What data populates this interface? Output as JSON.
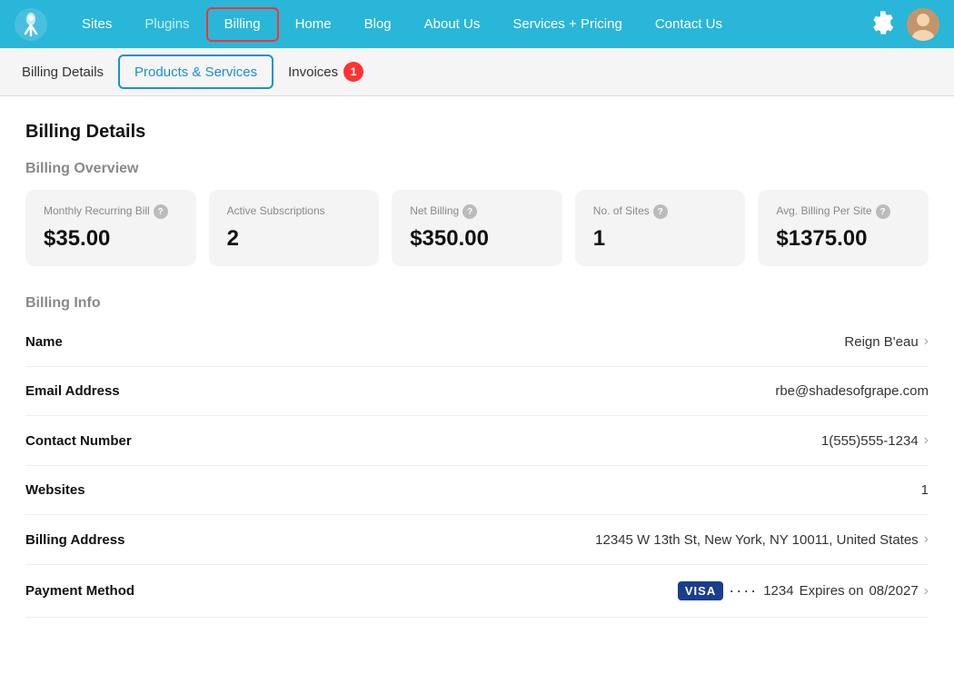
{
  "nav": {
    "links": [
      {
        "label": "Sites",
        "href": "#",
        "class": ""
      },
      {
        "label": "Plugins",
        "href": "#",
        "class": "plugins"
      },
      {
        "label": "Billing",
        "href": "#",
        "class": "active"
      },
      {
        "label": "Home",
        "href": "#",
        "class": ""
      },
      {
        "label": "Blog",
        "href": "#",
        "class": ""
      },
      {
        "label": "About Us",
        "href": "#",
        "class": ""
      },
      {
        "label": "Services + Pricing",
        "href": "#",
        "class": ""
      },
      {
        "label": "Contact Us",
        "href": "#",
        "class": ""
      }
    ]
  },
  "sub_nav": {
    "items": [
      {
        "label": "Billing Details",
        "class": ""
      },
      {
        "label": "Products & Services",
        "class": "active"
      },
      {
        "label": "Invoices",
        "class": "",
        "badge": "1"
      }
    ]
  },
  "page": {
    "title": "Billing Details",
    "overview_title": "Billing Overview",
    "cards": [
      {
        "label": "Monthly Recurring Bill",
        "value": "$35.00",
        "has_help": true
      },
      {
        "label": "Active Subscriptions",
        "value": "2",
        "has_help": false
      },
      {
        "label": "Net Billing",
        "value": "$350.00",
        "has_help": true
      },
      {
        "label": "No. of Sites",
        "value": "1",
        "has_help": true
      },
      {
        "label": "Avg. Billing Per Site",
        "value": "$1375.00",
        "has_help": true
      }
    ],
    "billing_info_title": "Billing Info",
    "info_rows": [
      {
        "label": "Name",
        "value": "Reign B'eau",
        "chevron": true
      },
      {
        "label": "Email Address",
        "value": "rbe@shadesofgrape.com",
        "chevron": false
      },
      {
        "label": "Contact Number",
        "value": "1(555)555-1234",
        "chevron": true
      },
      {
        "label": "Websites",
        "value": "1",
        "chevron": false
      },
      {
        "label": "Billing Address",
        "value": "12345 W 13th St, New York, NY 10011, United States",
        "chevron": true
      },
      {
        "label": "Payment Method",
        "value": null,
        "chevron": true,
        "payment": true
      }
    ],
    "payment": {
      "brand": "VISA",
      "dots": "····",
      "last4": "1234",
      "expires_label": "Expires on",
      "expiry": "08/2027"
    }
  }
}
